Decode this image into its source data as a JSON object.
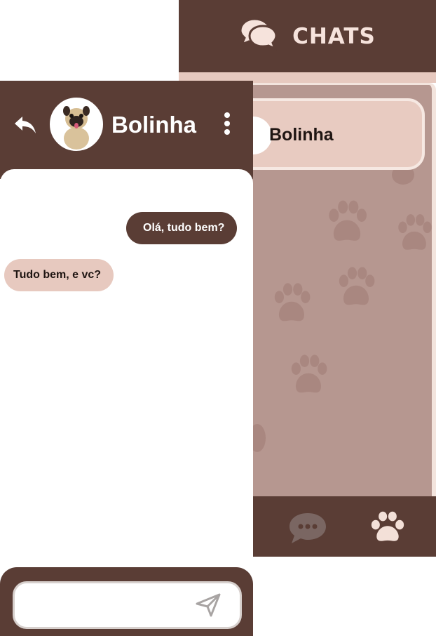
{
  "chats_screen": {
    "title": "CHATS",
    "chats": [
      {
        "name": "Bolinha"
      }
    ],
    "nav": [
      "chat-icon",
      "paw-icon"
    ]
  },
  "conversation": {
    "contact_name": "Bolinha",
    "avatar": "pug-photo",
    "messages": [
      {
        "direction": "sent",
        "text": "Olá, tudo bem?"
      },
      {
        "direction": "received",
        "text": "Tudo bem, e vc?"
      }
    ],
    "input": {
      "value": "",
      "placeholder": ""
    }
  },
  "colors": {
    "brown": "#5a3d35",
    "pink": "#e7c9bf",
    "panel": "#b69790",
    "paw": "#a98780",
    "cream": "#f6e3dc"
  }
}
